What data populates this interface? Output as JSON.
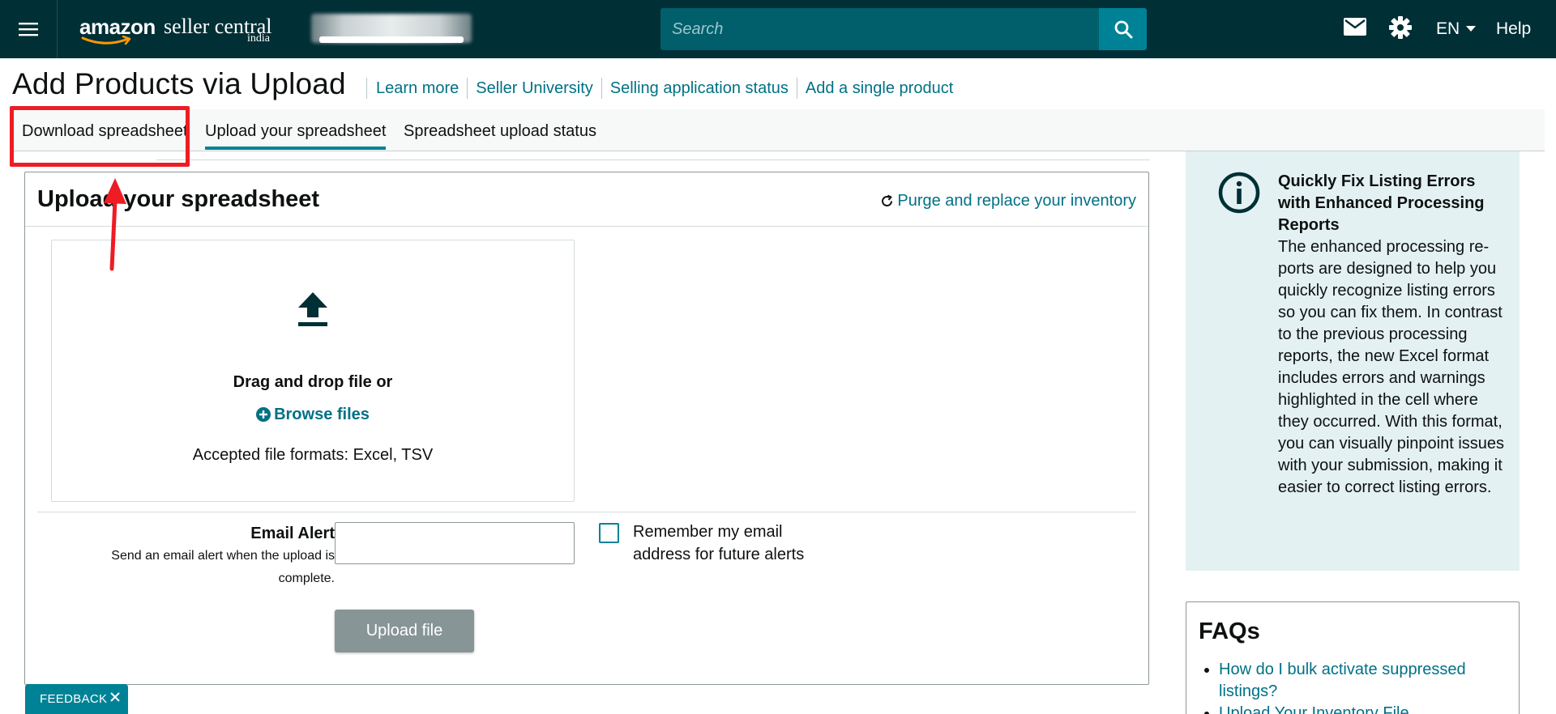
{
  "nav": {
    "logo_brand": "amazon",
    "logo_product": "seller central",
    "logo_region": "india",
    "search_placeholder": "Search",
    "language": "EN",
    "help": "Help"
  },
  "page": {
    "title": "Add Products via Upload",
    "links": [
      "Learn more",
      "Seller University",
      "Selling application status",
      "Add a single product"
    ]
  },
  "tabs": {
    "download": "Download spreadsheet",
    "upload": "Upload your spreadsheet",
    "status": "Spreadsheet upload status",
    "active": "upload"
  },
  "upload_card": {
    "title": "Upload your spreadsheet",
    "purge_link": "Purge and replace your inventory",
    "dropzone_title": "Drag and drop file or",
    "browse_label": "Browse files",
    "formats": "Accepted file formats: Excel, TSV",
    "email_label": "Email Alert",
    "email_desc": "Send an email alert when the upload is complete.",
    "email_value": "",
    "remember_label": "Remember my email address for future alerts",
    "remember_checked": false,
    "upload_button": "Upload file"
  },
  "info_panel": {
    "title": "Quickly Fix Listing Errors with Enhanced Processing Reports",
    "body": "The enhanced processing re­ports are designed to help you quickly recognize listing errors so you can fix them. In contrast to the previous pro­cessing reports, the new Excel format includes errors and warnings highlighted in the cell where they occurred. With this format, you can visually pinpoint issues with your submission, making it easier to correct listing er­rors."
  },
  "faq": {
    "title": "FAQs",
    "items": [
      "How do I bulk activate suppressed listings?",
      "Upload Your Inventory File"
    ]
  },
  "feedback": {
    "label": "FEEDBACK"
  },
  "colors": {
    "nav_bg": "#002f36",
    "search_bg": "#005f6b",
    "accent": "#008296",
    "link": "#007185",
    "info_bg": "#e3f1f2",
    "highlight": "#ee1c24",
    "disabled_button": "#879596"
  },
  "icons": [
    "menu-icon",
    "search-icon",
    "mail-icon",
    "gear-icon",
    "caret-down-icon",
    "refresh-icon",
    "upload-icon",
    "plus-circle-icon",
    "info-icon",
    "close-icon"
  ]
}
